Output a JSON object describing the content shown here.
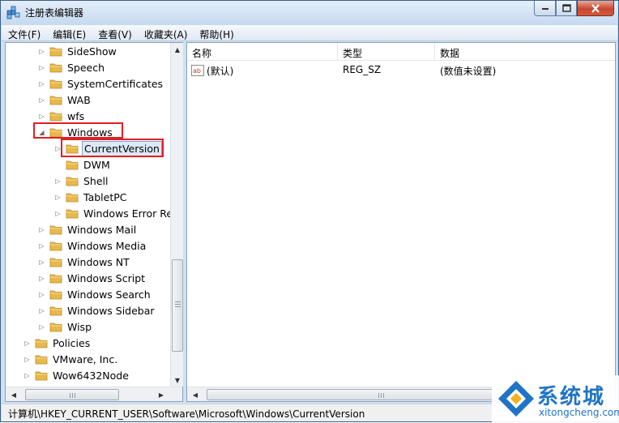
{
  "window": {
    "title": "注册表编辑器"
  },
  "menu": [
    "文件(F)",
    "编辑(E)",
    "查看(V)",
    "收藏夹(A)",
    "帮助(H)"
  ],
  "tree": [
    {
      "label": "SideShow",
      "expander": "▷"
    },
    {
      "label": "Speech",
      "expander": "▷"
    },
    {
      "label": "SystemCertificates",
      "expander": "▷"
    },
    {
      "label": "WAB",
      "expander": "▷"
    },
    {
      "label": "wfs",
      "expander": "▷"
    },
    {
      "label": "Windows",
      "expander": "◢",
      "expanded": true
    },
    {
      "label": "CurrentVersion",
      "expander": "▷",
      "selected": true
    },
    {
      "label": "DWM",
      "expander": ""
    },
    {
      "label": "Shell",
      "expander": "▷"
    },
    {
      "label": "TabletPC",
      "expander": "▷"
    },
    {
      "label": "Windows Error Re",
      "expander": "▷"
    },
    {
      "label": "Windows Mail",
      "expander": "▷"
    },
    {
      "label": "Windows Media",
      "expander": "▷"
    },
    {
      "label": "Windows NT",
      "expander": "▷"
    },
    {
      "label": "Windows Script",
      "expander": "▷"
    },
    {
      "label": "Windows Search",
      "expander": "▷"
    },
    {
      "label": "Windows Sidebar",
      "expander": "▷"
    },
    {
      "label": "Wisp",
      "expander": "▷"
    },
    {
      "label": "Policies",
      "expander": "▷"
    },
    {
      "label": "VMware, Inc.",
      "expander": "▷"
    },
    {
      "label": "Wow6432Node",
      "expander": "▷"
    }
  ],
  "list": {
    "columns": [
      "名称",
      "类型",
      "数据"
    ],
    "rows": [
      {
        "name": "(默认)",
        "type": "REG_SZ",
        "data": "(数值未设置)",
        "icon": "ab"
      }
    ]
  },
  "status": {
    "path": "计算机\\HKEY_CURRENT_USER\\Software\\Microsoft\\Windows\\CurrentVersion"
  },
  "watermark": {
    "brand": "系统城",
    "site": "xitongcheng.com"
  },
  "colors": {
    "highlight": "#e01f26",
    "folder": "#e8b94a",
    "watermark": "#1f74c4"
  }
}
